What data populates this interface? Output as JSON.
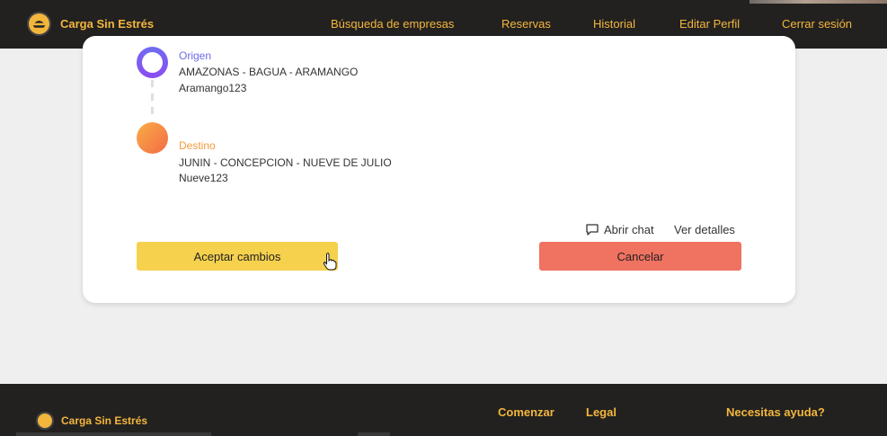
{
  "header": {
    "brand": "Carga Sin Estrés",
    "nav": [
      {
        "label": "Búsqueda de empresas"
      },
      {
        "label": "Reservas"
      },
      {
        "label": "Historial"
      },
      {
        "label": "Editar Perfil"
      },
      {
        "label": "Cerrar sesión"
      }
    ]
  },
  "route": {
    "origin": {
      "label": "Origen",
      "location": "AMAZONAS - BAGUA - ARAMANGO",
      "address": "Aramango123"
    },
    "destination": {
      "label": "Destino",
      "location": "JUNIN - CONCEPCION - NUEVE DE JULIO",
      "address": "Nueve123"
    }
  },
  "actions": {
    "open_chat": "Abrir chat",
    "view_details": "Ver detalles",
    "accept": "Aceptar cambios",
    "cancel": "Cancelar"
  },
  "footer": {
    "brand": "Carga Sin Estrés",
    "links": [
      "Comenzar",
      "Legal",
      "Necesitas ayuda?"
    ]
  },
  "colors": {
    "nav_bg": "#222120",
    "accent": "#f4b63c",
    "origin": "#6d6ae8",
    "destination": "#f59a3a",
    "accept_btn": "#f6d14e",
    "cancel_btn": "#f07260"
  },
  "icons": [
    "truck-logo-icon",
    "chat-icon",
    "hand-pointer-cursor-icon"
  ]
}
